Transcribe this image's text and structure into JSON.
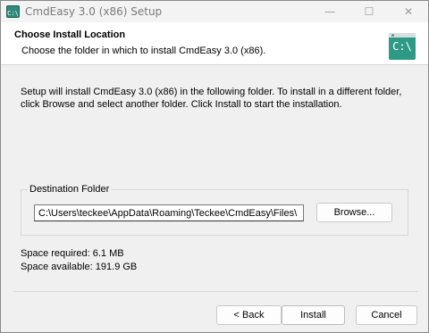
{
  "window": {
    "title": "CmdEasy 3.0 (x86) Setup",
    "app_icon_text": "C:\\",
    "minimize_glyph": "—",
    "maximize_glyph": "☐",
    "close_glyph": "✕"
  },
  "header": {
    "title": "Choose Install Location",
    "subtitle": "Choose the folder in which to install CmdEasy 3.0 (x86).",
    "logo_text": "C:\\"
  },
  "body": {
    "intro": "Setup will install CmdEasy 3.0 (x86) in the following folder. To install in a different folder, click Browse and select another folder. Click Install to start the installation.",
    "destination_label": "Destination Folder",
    "destination_path": "C:\\Users\\teckee\\AppData\\Roaming\\Teckee\\CmdEasy\\Files\\",
    "browse_label": "Browse...",
    "space_required": "Space required: 6.1 MB",
    "space_available": "Space available: 191.9 GB"
  },
  "footer": {
    "back_label": "< Back",
    "install_label": "Install",
    "cancel_label": "Cancel"
  },
  "colors": {
    "accent": "#2e9a86",
    "window_bg": "#f0f0f0",
    "header_bg": "#ffffff"
  },
  "icons": {
    "app": "cmdeasy-app-icon",
    "logo": "cmdeasy-logo-icon"
  }
}
